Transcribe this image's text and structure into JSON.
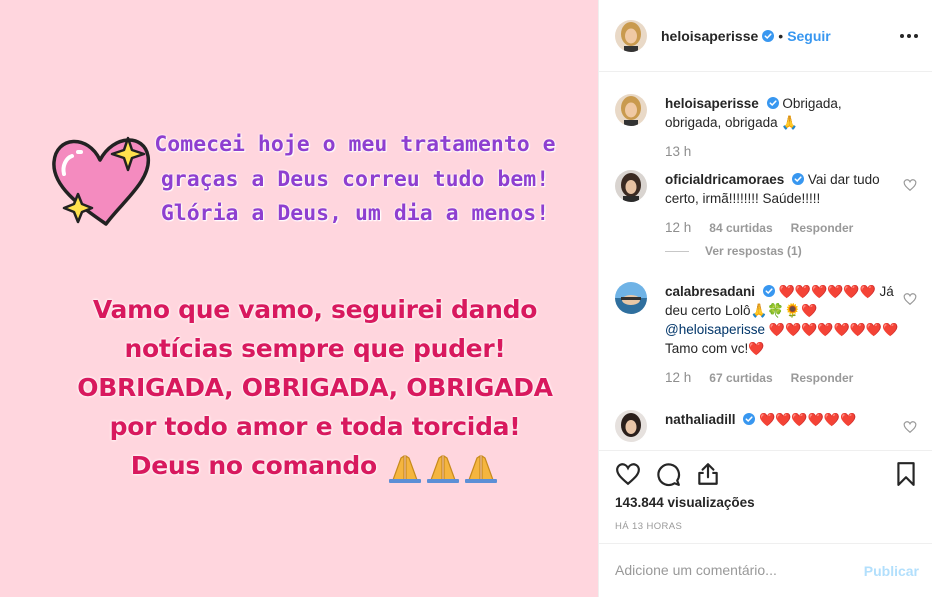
{
  "media": {
    "story_text_1": "Comecei hoje o meu tratamento e graças a Deus correu tudo bem! Glória a Deus, um dia a menos!",
    "story_text_2_lines": [
      "Vamo que vamo, seguirei dando",
      "notícias sempre que puder!",
      "OBRIGADA, OBRIGADA, OBRIGADA",
      "por todo amor e toda torcida!",
      "Deus no comando"
    ],
    "background_color": "#ffd6de"
  },
  "header": {
    "username": "heloisaperisse",
    "separator": "•",
    "follow_label": "Seguir"
  },
  "comments": [
    {
      "username": "heloisaperisse",
      "text": "Obrigada, obrigada, obrigada",
      "emoji": "🙏",
      "time": "13 h"
    },
    {
      "username": "oficialdricamoraes",
      "text": "Vai dar tudo certo, irmã!!!!!!!! Saúde!!!!!",
      "time": "12 h",
      "likes": "84 curtidas",
      "reply_label": "Responder",
      "view_replies": "Ver respostas (1)"
    },
    {
      "username": "calabresadani",
      "text_a": "Já deu certo Lolô",
      "mention": "@heloisaperisse",
      "text_b": "Tamo com vc!",
      "time": "12 h",
      "likes": "67 curtidas",
      "reply_label": "Responder"
    },
    {
      "username": "nathaliadill"
    }
  ],
  "actions": {
    "views": "143.844 visualizações",
    "ago": "HÁ 13 HORAS",
    "comment_placeholder": "Adicione um comentário...",
    "publish_label": "Publicar"
  },
  "colors": {
    "accent": "#3897f0",
    "verified": "#3897f0",
    "text": "#262626",
    "muted": "#999999",
    "publish_disabled": "#b2dffc",
    "story_purple": "#8e3fd0",
    "story_pink": "#d8195e"
  },
  "icons": [
    "verified-badge-icon",
    "more-options-icon",
    "heart-icon",
    "comment-icon",
    "share-icon",
    "bookmark-icon",
    "pray-emoji",
    "heart-emoji",
    "four-leaf-clover-emoji",
    "sunflower-emoji"
  ]
}
